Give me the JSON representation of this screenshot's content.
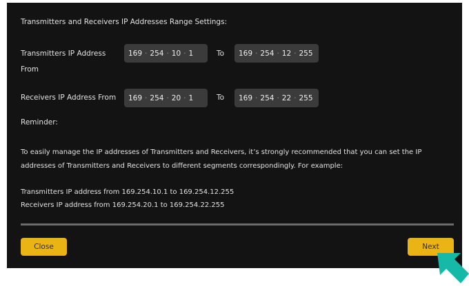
{
  "dialog": {
    "heading": "Transmitters and Receivers IP Addresses Range Settings:",
    "tx_label_line1": "Transmitters IP Address",
    "tx_label_line2": "From",
    "rx_label": "Receivers IP Address From",
    "to_label": "To",
    "tx_from": [
      "169",
      "254",
      "10",
      "1"
    ],
    "tx_to": [
      "169",
      "254",
      "12",
      "255"
    ],
    "rx_from": [
      "169",
      "254",
      "20",
      "1"
    ],
    "rx_to": [
      "169",
      "254",
      "22",
      "255"
    ],
    "reminder_title": "Reminder:",
    "reminder_line1": "To easily manage the IP addresses of Transmitters and Receivers, it’s strongly recommended that you can set the IP",
    "reminder_line2": "addresses of Transmitters and Receivers to different segments correspondingly. For example:",
    "example_tx": "Transmitters IP address from 169.254.10.1 to 169.254.12.255",
    "example_rx": "Receivers IP address from 169.254.20.1 to 169.254.22.255"
  },
  "buttons": {
    "close": "Close",
    "next": "Next"
  },
  "colors": {
    "accent": "#eab415",
    "cursor": "#16b8a8",
    "background": "#131313"
  }
}
